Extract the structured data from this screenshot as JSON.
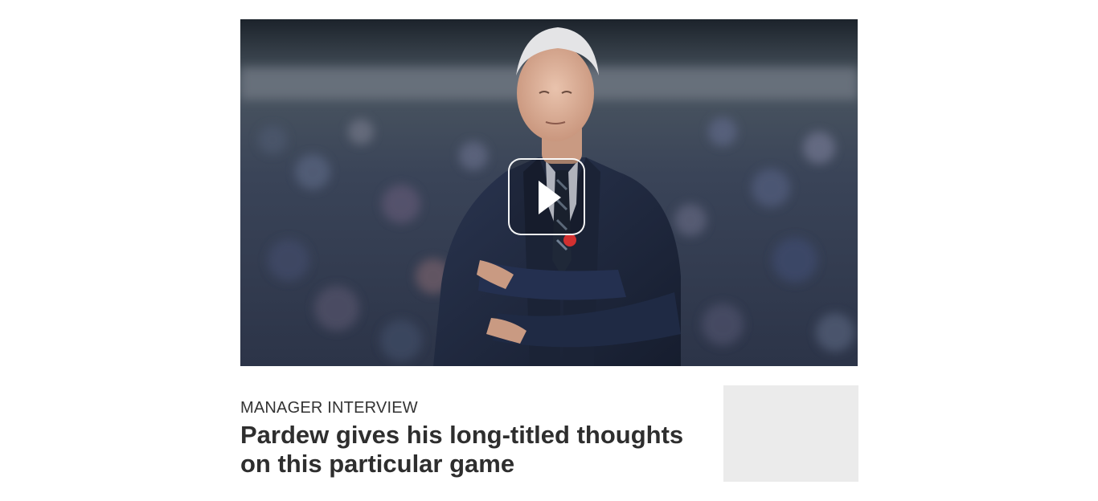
{
  "video": {
    "thumbnail_alt": "Alan Pardew standing with arms crossed in front of a blurred stadium crowd",
    "play_icon": "play-icon"
  },
  "article": {
    "kicker": "MANAGER INTERVIEW",
    "headline": "Pardew gives his long-titled thoughts on this particular game"
  },
  "ad_slot": {
    "color": "#ebebeb"
  },
  "colors": {
    "text": "#333333",
    "headline": "#2e2e2e",
    "background": "#ffffff"
  }
}
